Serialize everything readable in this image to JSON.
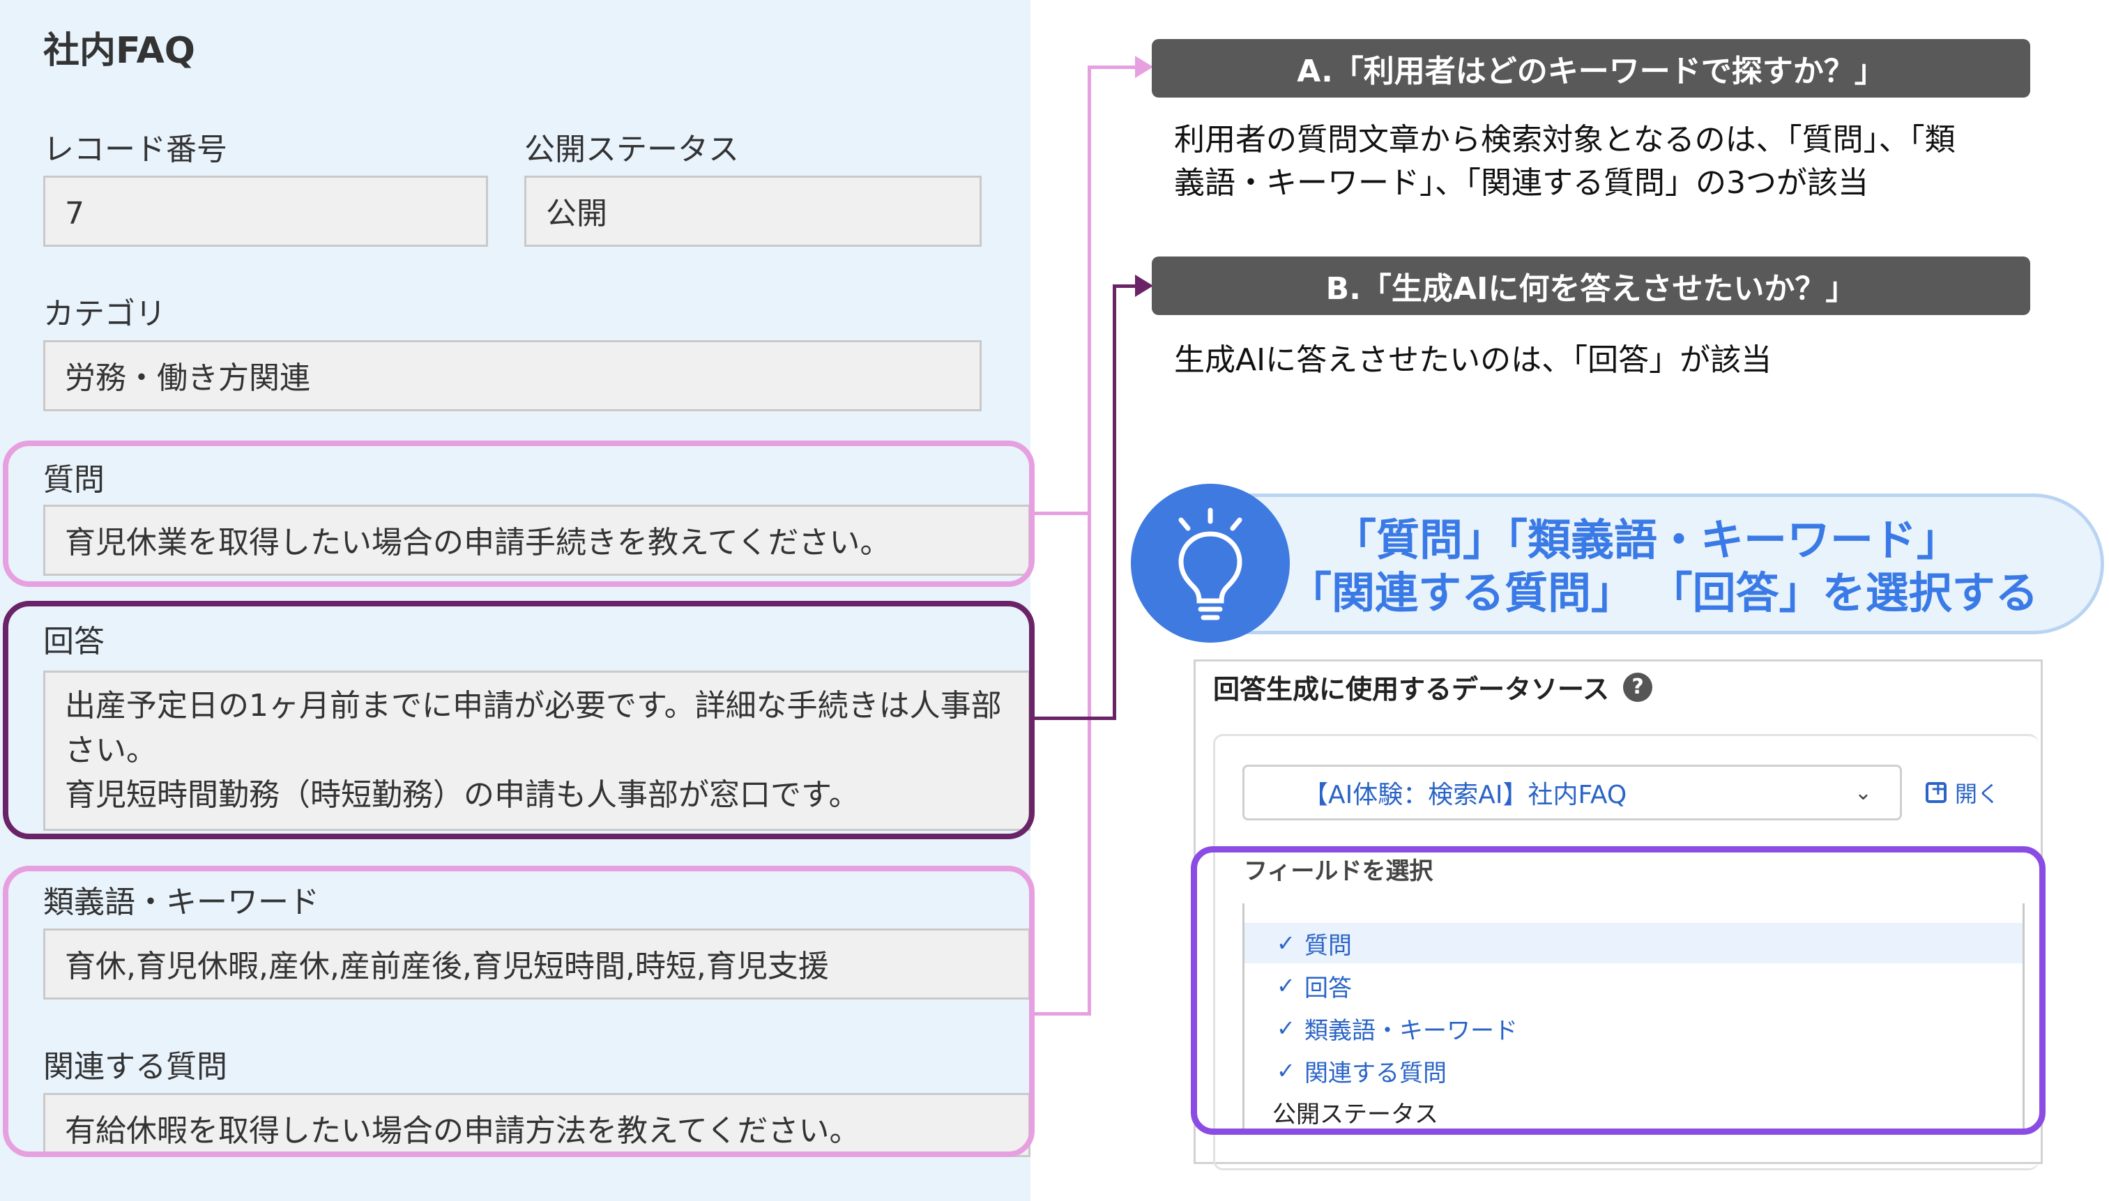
{
  "form": {
    "title": "社内FAQ",
    "record_number": {
      "label": "レコード番号",
      "value": "7"
    },
    "publish_status": {
      "label": "公開ステータス",
      "value": "公開"
    },
    "category": {
      "label": "カテゴリ",
      "value": "労務・働き方関連"
    },
    "question": {
      "label": "質問",
      "value": "育児休業を取得したい場合の申請手続きを教えてください。"
    },
    "answer": {
      "label": "回答",
      "lines": [
        "出産予定日の1ヶ月前までに申請が必要です。詳細な手続きは人事部",
        "さい。",
        "育児短時間勤務（時短勤務）の申請も人事部が窓口です。"
      ]
    },
    "synonyms": {
      "label": "類義語・キーワード",
      "value": "育休,育児休暇,産休,産前産後,育児短時間,時短,育児支援"
    },
    "related": {
      "label": "関連する質問",
      "value": "有給休暇を取得したい場合の申請方法を教えてください。"
    }
  },
  "annotations": {
    "a_title": "A.「利用者はどのキーワードで探すか？」",
    "a_desc_line1": "利用者の質問文章から検索対象となるのは、「質問」、「類",
    "a_desc_line2": "義語・キーワード」、「関連する質問」の3つが該当",
    "b_title": "B.「生成AIに何を答えさせたいか？」",
    "b_desc": "生成AIに答えさせたいのは、「回答」が該当",
    "tip_line1": "「質問」「類義語・キーワード」",
    "tip_line2": "「関連する質問」 「回答」を選択する"
  },
  "datasource": {
    "title": "回答生成に使用するデータソース",
    "help_icon": "question-circle-icon",
    "selected_source": "【AI体験：検索AI】社内FAQ",
    "open_label": "開く",
    "field_label": "フィールドを選択",
    "fields": [
      {
        "label": "質問",
        "checked": true
      },
      {
        "label": "回答",
        "checked": true
      },
      {
        "label": "類義語・キーワード",
        "checked": true
      },
      {
        "label": "関連する質問",
        "checked": true
      },
      {
        "label": "公開ステータス",
        "checked": false
      }
    ]
  },
  "colors": {
    "panel_bg": "#e9f3fc",
    "highlight_pink": "#e7a0df",
    "highlight_dark_purple": "#6a2367",
    "banner_bg": "#595959",
    "tip_text": "#3a7ae6",
    "selection_outline": "#8b4ce3"
  }
}
